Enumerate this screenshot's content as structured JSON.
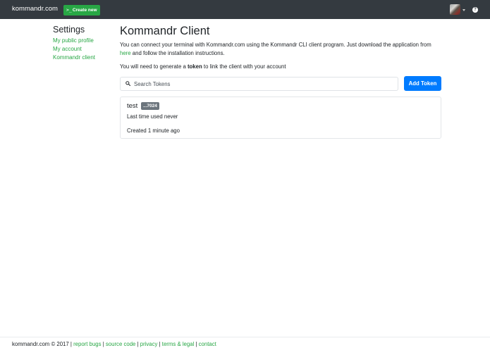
{
  "navbar": {
    "brand": "kommandr.com",
    "create_prompt": ">_",
    "create_label": "Create new",
    "help_glyph": "?"
  },
  "sidebar": {
    "title": "Settings",
    "links": [
      "My public profile",
      "My account",
      "Kommandr client"
    ]
  },
  "main": {
    "title": "Kommandr Client",
    "desc_before": "You can connect your terminal with Kommandr.com using the Kommandr CLI client program. Just download the application from ",
    "desc_link": "here",
    "desc_after": "  and follow the installation instructions.",
    "hint_before": "You will need to generate a ",
    "hint_bold": "token",
    "hint_after": " to link the client with your account",
    "search_placeholder": "Search Tokens",
    "add_token_label": "Add Token"
  },
  "token": {
    "name": "test",
    "badge": "...7024",
    "last_used": "Last time used never",
    "created": "Created 1 minute ago"
  },
  "footer": {
    "copyright": "kommandr.com © 2017",
    "links": [
      "report bugs",
      "source code",
      "privacy",
      "terms & legal",
      "contact"
    ]
  },
  "colors": {
    "navbar_bg": "#343a40",
    "accent_green": "#28a745",
    "primary_blue": "#007bff",
    "badge_gray": "#6c757d"
  }
}
